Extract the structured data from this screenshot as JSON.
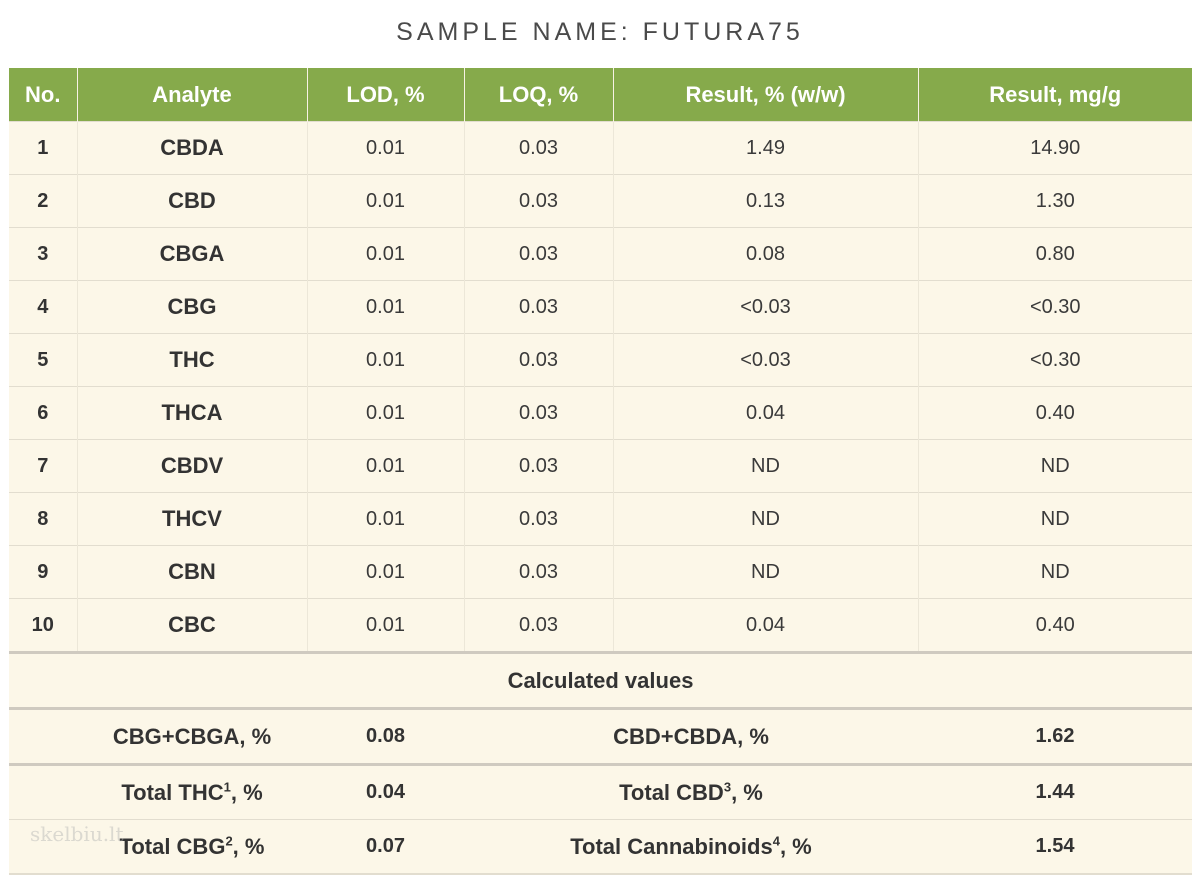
{
  "title": "SAMPLE NAME: FUTURA75",
  "headers": [
    "No.",
    "Analyte",
    "LOD, %",
    "LOQ, %",
    "Result, % (w/w)",
    "Result, mg/g"
  ],
  "rows": [
    {
      "no": "1",
      "analyte": "CBDA",
      "lod": "0.01",
      "loq": "0.03",
      "pct": "1.49",
      "mg": "14.90"
    },
    {
      "no": "2",
      "analyte": "CBD",
      "lod": "0.01",
      "loq": "0.03",
      "pct": "0.13",
      "mg": "1.30"
    },
    {
      "no": "3",
      "analyte": "CBGA",
      "lod": "0.01",
      "loq": "0.03",
      "pct": "0.08",
      "mg": "0.80"
    },
    {
      "no": "4",
      "analyte": "CBG",
      "lod": "0.01",
      "loq": "0.03",
      "pct": "<0.03",
      "mg": "<0.30"
    },
    {
      "no": "5",
      "analyte": "THC",
      "lod": "0.01",
      "loq": "0.03",
      "pct": "<0.03",
      "mg": "<0.30"
    },
    {
      "no": "6",
      "analyte": "THCA",
      "lod": "0.01",
      "loq": "0.03",
      "pct": "0.04",
      "mg": "0.40"
    },
    {
      "no": "7",
      "analyte": "CBDV",
      "lod": "0.01",
      "loq": "0.03",
      "pct": "ND",
      "mg": "ND"
    },
    {
      "no": "8",
      "analyte": "THCV",
      "lod": "0.01",
      "loq": "0.03",
      "pct": "ND",
      "mg": "ND"
    },
    {
      "no": "9",
      "analyte": "CBN",
      "lod": "0.01",
      "loq": "0.03",
      "pct": "ND",
      "mg": "ND"
    },
    {
      "no": "10",
      "analyte": "CBC",
      "lod": "0.01",
      "loq": "0.03",
      "pct": "0.04",
      "mg": "0.40"
    }
  ],
  "section_label": "Calculated values",
  "calculated": [
    {
      "left_label": "CBG+CBGA, %",
      "left_sup": "",
      "left_value": "0.08",
      "right_label": "CBD+CBDA, %",
      "right_sup": "",
      "right_value": "1.62"
    },
    {
      "left_label": "Total THC",
      "left_sup": "1",
      "left_suffix": ", %",
      "left_value": "0.04",
      "right_label": "Total CBD",
      "right_sup": "3",
      "right_suffix": ", %",
      "right_value": "1.44"
    },
    {
      "left_label": "Total CBG",
      "left_sup": "2",
      "left_suffix": ", %",
      "left_value": "0.07",
      "right_label": "Total Cannabinoids",
      "right_sup": "4",
      "right_suffix": ", %",
      "right_value": "1.54"
    }
  ],
  "watermark": "skelbiu.lt"
}
